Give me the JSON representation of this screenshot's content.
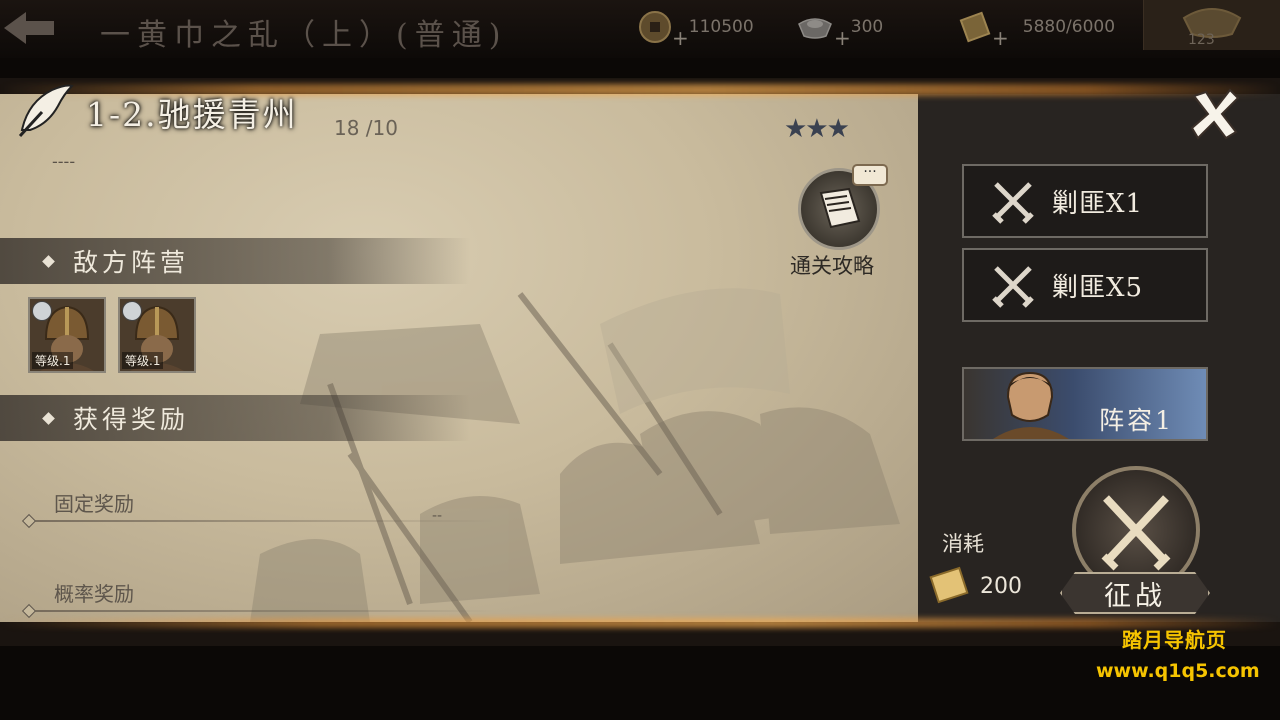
{
  "topbar": {
    "chapter_title": "一黄巾之乱（上）(普通)",
    "resources": [
      {
        "icon": "copper-coin-icon",
        "value": "110500"
      },
      {
        "icon": "silver-ingot-icon",
        "value": "300"
      },
      {
        "icon": "stamina-scroll-icon",
        "value": "5880/6000"
      }
    ],
    "gold_count": "123"
  },
  "stage": {
    "title": "1-2.驰援青州",
    "progress": "18 /10",
    "stars": "★★★",
    "description": "----"
  },
  "guide": {
    "label": "通关攻略",
    "bubble": "···"
  },
  "enemy_section": {
    "title": "敌方阵营",
    "units": [
      {
        "level": "等级.1"
      },
      {
        "level": "等级.1"
      }
    ]
  },
  "reward_section": {
    "title": "获得奖励",
    "fixed_label": "固定奖励",
    "fixed_value": "--",
    "chance_label": "概率奖励"
  },
  "actions": {
    "sweep1": "剿匪X1",
    "sweep5": "剿匪X5",
    "lineup": "阵容1",
    "cost_label": "消耗",
    "cost_value": "200",
    "fight": "征战"
  },
  "watermark": {
    "line1": "踏月导航页",
    "line2": "www.q1q5.com"
  },
  "colors": {
    "accent_glow": "#e6963c",
    "watermark": "#f6c400",
    "star": "#3a4150"
  }
}
